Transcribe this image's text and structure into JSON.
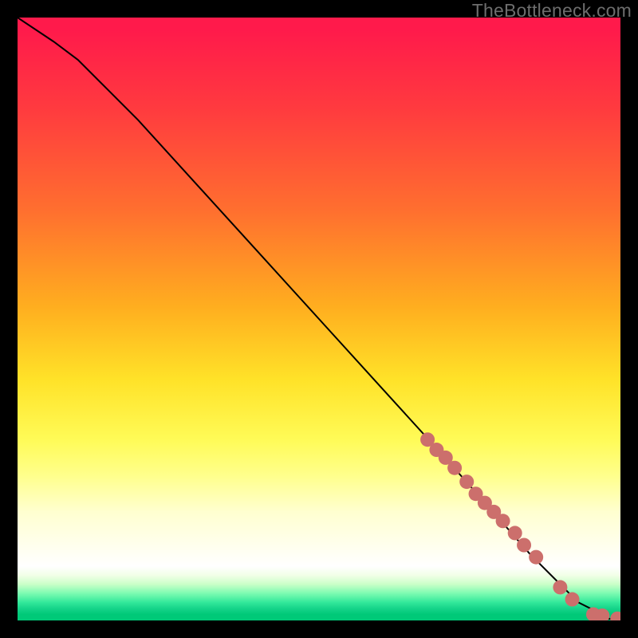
{
  "watermark": "TheBottleneck.com",
  "colors": {
    "frame": "#000000",
    "curve": "#000000",
    "marker_fill": "#cc6f6c",
    "marker_stroke": "#b85b58"
  },
  "chart_data": {
    "type": "line",
    "title": "",
    "xlabel": "",
    "ylabel": "",
    "xlim": [
      0,
      100
    ],
    "ylim": [
      0,
      100
    ],
    "grid": false,
    "legend": false,
    "curve": {
      "x": [
        0,
        3,
        6,
        10,
        15,
        20,
        30,
        40,
        50,
        60,
        70,
        78,
        85,
        90,
        93,
        95,
        97,
        98,
        99,
        100
      ],
      "y": [
        100,
        98,
        96,
        93,
        88,
        83,
        72,
        61,
        50,
        39,
        28,
        19,
        11,
        6,
        3,
        2,
        1,
        0.3,
        0.2,
        0
      ]
    },
    "markers": {
      "x": [
        68.0,
        69.5,
        71.0,
        72.5,
        74.5,
        76.0,
        77.5,
        79.0,
        80.5,
        82.5,
        84.0,
        86.0,
        90.0,
        92.0,
        95.5,
        97.0,
        99.5
      ],
      "y": [
        30.0,
        28.3,
        27.0,
        25.3,
        23.0,
        21.0,
        19.5,
        18.0,
        16.5,
        14.5,
        12.5,
        10.5,
        5.5,
        3.5,
        1.0,
        0.8,
        0.3
      ]
    }
  }
}
